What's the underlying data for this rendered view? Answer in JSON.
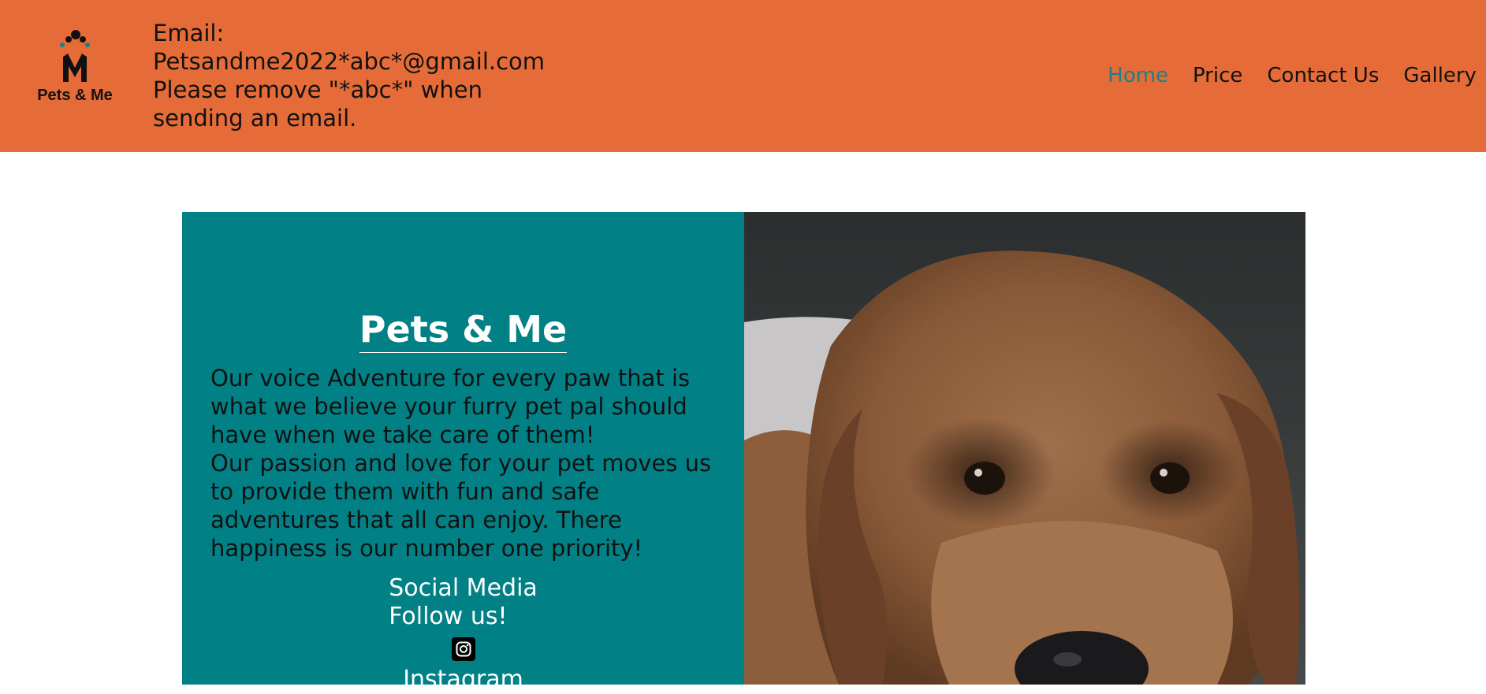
{
  "header": {
    "logo_text": "Pets & Me",
    "email_lines": [
      "Email:",
      "Petsandme2022*abc*@gmail.com",
      "Please remove \"*abc*\" when",
      "sending an email."
    ]
  },
  "nav": {
    "items": [
      {
        "label": "Home",
        "active": true
      },
      {
        "label": "Price",
        "active": false
      },
      {
        "label": "Contact Us",
        "active": false
      },
      {
        "label": "Gallery",
        "active": false
      }
    ]
  },
  "hero": {
    "title": "Pets & Me",
    "paragraph_lines": [
      "Our voice Adventure for every paw that is",
      "what we believe your furry pet pal should",
      "have when we take care of them!",
      "Our passion and love for your pet moves us",
      "to provide them with fun and safe",
      "adventures that all can enjoy. There",
      "happiness is our number one priority!"
    ],
    "social_heading": "Social Media",
    "social_follow": "Follow us!",
    "instagram_label": "Instagram",
    "image": "dog-photo"
  },
  "colors": {
    "header_bg": "#e56c38",
    "hero_panel_bg": "#018186",
    "nav_active": "#1d8086"
  }
}
